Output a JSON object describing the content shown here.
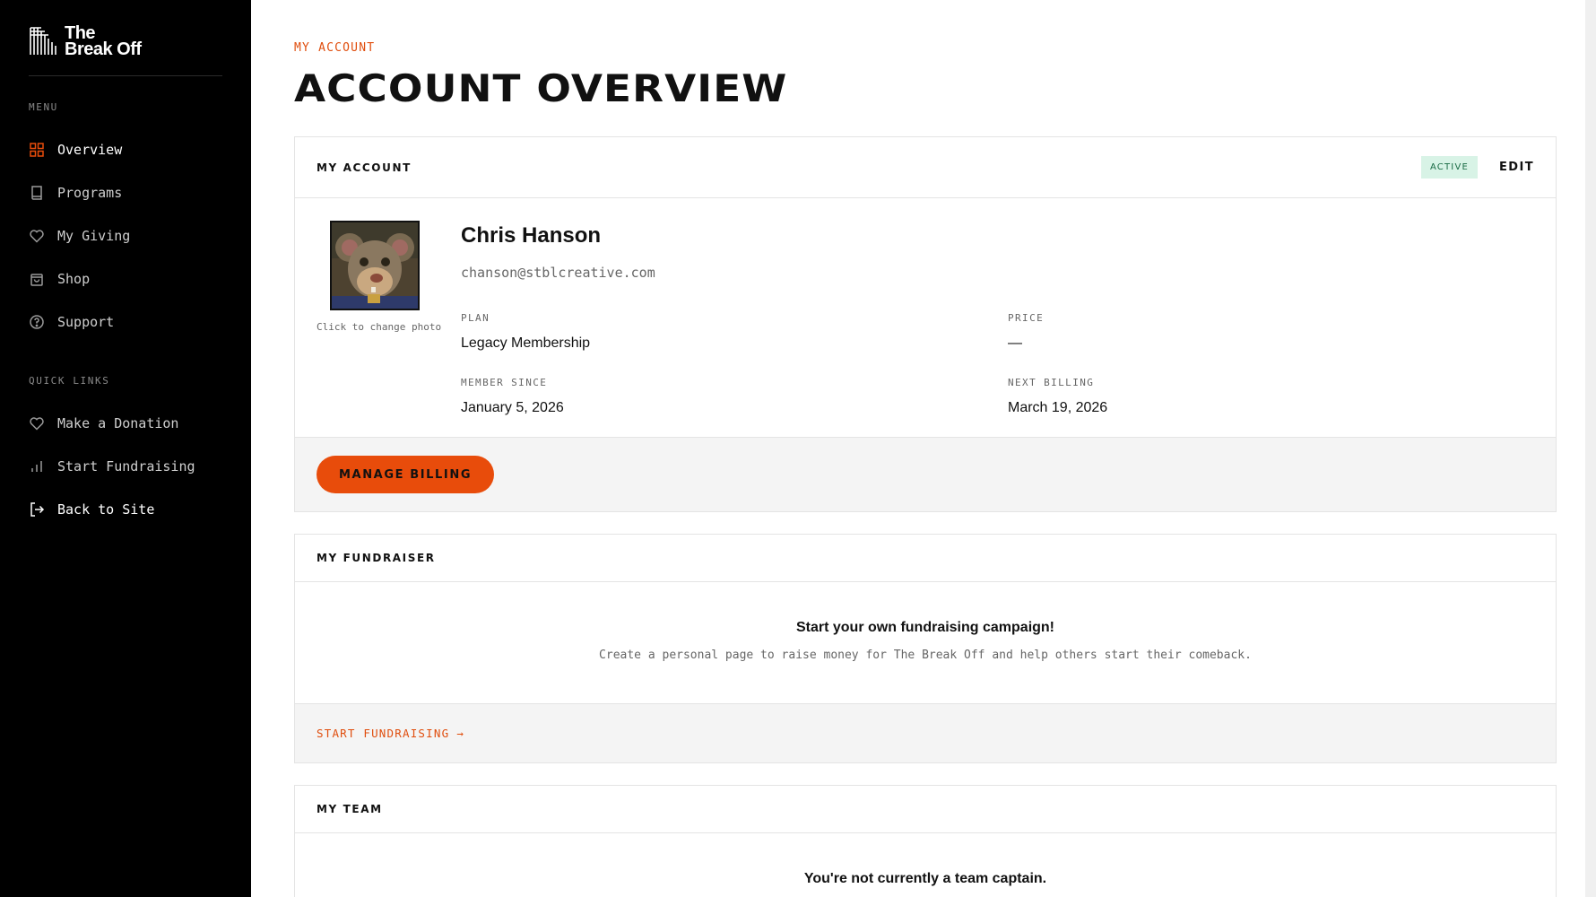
{
  "brand": {
    "name_line1": "The",
    "name_line2": "Break Off",
    "accent_color": "#e84c0b"
  },
  "sidebar": {
    "menu_label": "MENU",
    "menu_items": [
      {
        "label": "Overview",
        "icon": "grid-icon",
        "active": true
      },
      {
        "label": "Programs",
        "icon": "book-icon"
      },
      {
        "label": "My Giving",
        "icon": "heart-icon"
      },
      {
        "label": "Shop",
        "icon": "bag-icon"
      },
      {
        "label": "Support",
        "icon": "help-circle-icon"
      }
    ],
    "quick_links_label": "QUICK LINKS",
    "quick_links": [
      {
        "label": "Make a Donation",
        "icon": "heart-icon"
      },
      {
        "label": "Start Fundraising",
        "icon": "bar-chart-icon"
      },
      {
        "label": "Back to Site",
        "icon": "exit-icon"
      }
    ]
  },
  "header": {
    "breadcrumb": "MY ACCOUNT",
    "title": "ACCOUNT OVERVIEW"
  },
  "account_card": {
    "title": "MY ACCOUNT",
    "status": "ACTIVE",
    "edit_label": "EDIT",
    "photo_caption": "Click to change photo",
    "name": "Chris Hanson",
    "email": "chanson@stblcreative.com",
    "plan_label": "PLAN",
    "plan_value": "Legacy Membership",
    "price_label": "PRICE",
    "price_value": "—",
    "member_since_label": "MEMBER SINCE",
    "member_since_value": "January 5, 2026",
    "next_billing_label": "NEXT BILLING",
    "next_billing_value": "March 19, 2026",
    "manage_billing_label": "MANAGE BILLING"
  },
  "fundraiser_card": {
    "title": "MY FUNDRAISER",
    "headline": "Start your own fundraising campaign!",
    "description": "Create a personal page to raise money for The Break Off and help others start their comeback.",
    "cta_label": "START FUNDRAISING",
    "cta_arrow": "→"
  },
  "team_card": {
    "title": "MY TEAM",
    "headline": "You're not currently a team captain."
  }
}
